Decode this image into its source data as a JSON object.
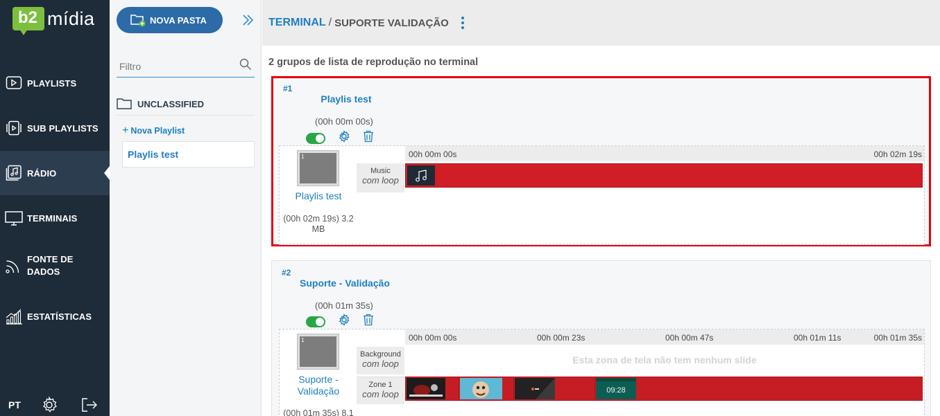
{
  "brand": {
    "badge": "b2",
    "name": "mídia"
  },
  "sidebar": {
    "items": [
      {
        "label": "PLAYLISTS",
        "icon": "play-square-icon"
      },
      {
        "label": "SUB PLAYLISTS",
        "icon": "sub-playlists-icon"
      },
      {
        "label": "RÁDIO",
        "icon": "radio-music-icon"
      },
      {
        "label": "TERMINAIS",
        "icon": "monitor-icon"
      },
      {
        "label": "FONTE DE DADOS",
        "icon": "rss-icon"
      },
      {
        "label": "ESTATÍSTICAS",
        "icon": "bar-chart-icon"
      }
    ],
    "active": "RÁDIO",
    "language": "PT"
  },
  "panel": {
    "new_folder_label": "NOVA PASTA",
    "filter_placeholder": "Filtro",
    "folder_label": "UNCLASSIFIED",
    "new_playlist_label": "Nova Playlist",
    "playlist_item": "Playlis test"
  },
  "header": {
    "crumb_link": "TERMINAL",
    "separator": "/",
    "crumb_current": "SUPORTE VALIDAÇÃO"
  },
  "heading": "2 grupos de lista de reprodução no terminal",
  "groups": [
    {
      "num": "#1",
      "title": "Playlis test",
      "duration": "(00h 00m 00s)",
      "thumb_index": "1",
      "thumb_title": "Playlis test",
      "meta": "(00h 02m 19s) 3.2 MB",
      "ticks": [
        "00h 00m 00s",
        "00h 02m 19s"
      ],
      "zones": [
        {
          "name": "Music",
          "loop": "com loop"
        }
      ]
    },
    {
      "num": "#2",
      "title": "Suporte - Validação",
      "duration": "(00h 01m 35s)",
      "thumb_index": "1",
      "thumb_title": "Suporte - Validação",
      "meta": "(00h 01m 35s) 8.1",
      "ticks": [
        "00h 00m 00s",
        "00h 00m 23s",
        "00h 00m 47s",
        "00h 01m 11s",
        "00h 01m 35s"
      ],
      "zones": [
        {
          "name": "Background",
          "loop": "com loop"
        },
        {
          "name": "Zone 1",
          "loop": "com loop"
        }
      ],
      "empty_zone_text": "Esta zona de tela não tem nenhum slide",
      "clock_text": "09:28"
    }
  ],
  "colors": {
    "accent": "#1e7fc0",
    "sidebar": "#1e2b38",
    "selected_border": "#e3000f",
    "timeline_bar": "#d01d26",
    "toggle_on": "#27a745"
  }
}
